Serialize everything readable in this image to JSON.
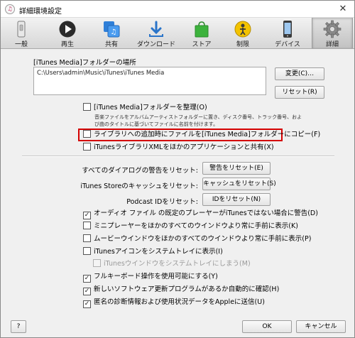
{
  "window": {
    "title": "詳細環境設定"
  },
  "toolbar": {
    "items": [
      {
        "id": "general",
        "label": "一般"
      },
      {
        "id": "playback",
        "label": "再生"
      },
      {
        "id": "sharing",
        "label": "共有"
      },
      {
        "id": "downloads",
        "label": "ダウンロード"
      },
      {
        "id": "store",
        "label": "ストア"
      },
      {
        "id": "restrictions",
        "label": "制限"
      },
      {
        "id": "devices",
        "label": "デバイス"
      },
      {
        "id": "advanced",
        "label": "詳細"
      }
    ],
    "active": "advanced"
  },
  "media_folder": {
    "label": "[iTunes Media]フォルダーの場所",
    "path": "C:\\Users\\admin\\Music\\iTunes\\iTunes Media",
    "change_button": "変更(C)…",
    "reset_button": "リセット(R)"
  },
  "options": {
    "organize": {
      "label": "[iTunes Media]フォルダーを整理(O)",
      "checked": false,
      "description": "音楽ファイルをアルバムアーティストフォルダーに置き、ディスク番号、トラック番号、および曲のタイトルに基づいてファイルに名前を付けます。"
    },
    "copy_to_folder": {
      "label": "ライブラリへの追加時にファイルを[iTunes Media]フォルダーにコピー(F)",
      "checked": false
    },
    "share_xml": {
      "label": "iTunesライブラリXMLをほかのアプリケーションと共有(X)",
      "checked": false
    }
  },
  "resets": {
    "dialog_warnings": {
      "label": "すべてのダイアログの警告をリセット:",
      "button": "警告をリセット(E)"
    },
    "store_cache": {
      "label": "iTunes Storeのキャッシュをリセット:",
      "button": "キャッシュをリセット(S)"
    },
    "podcast_id": {
      "label": "Podcast IDをリセット:",
      "button": "IDをリセット(N)"
    }
  },
  "checks": {
    "audio_warning": {
      "label": "オーディオ ファイル の既定のプレーヤーがiTunesではない場合に警告(D)",
      "checked": true
    },
    "miniplayer_top": {
      "label": "ミニプレーヤーをほかのすべてのウインドウより常に手前に表示(K)",
      "checked": false
    },
    "movie_top": {
      "label": "ムービーウインドウをほかのすべてのウインドウより常に手前に表示(P)",
      "checked": false
    },
    "tray_icon": {
      "label": "iTunesアイコンをシステムトレイに表示(I)",
      "checked": false
    },
    "minimize_tray": {
      "label": "iTunesウインドウをシステムトレイにしまう(M)",
      "checked": false
    },
    "keyboard_nav": {
      "label": "フルキーボード操作を使用可能にする(Y)",
      "checked": true
    },
    "check_updates": {
      "label": "新しいソフトウェア更新プログラムがあるか自動的に確認(H)",
      "checked": true
    },
    "send_diagnostics": {
      "label": "匿名の診断情報および使用状況データをAppleに送信(U)",
      "checked": true
    }
  },
  "footer": {
    "help": "?",
    "ok": "OK",
    "cancel": "キャンセル"
  },
  "colors": {
    "highlight_border": "#d40000",
    "toolbar_bg": "#d6d6d6",
    "window_bg": "#f0f0f0"
  }
}
